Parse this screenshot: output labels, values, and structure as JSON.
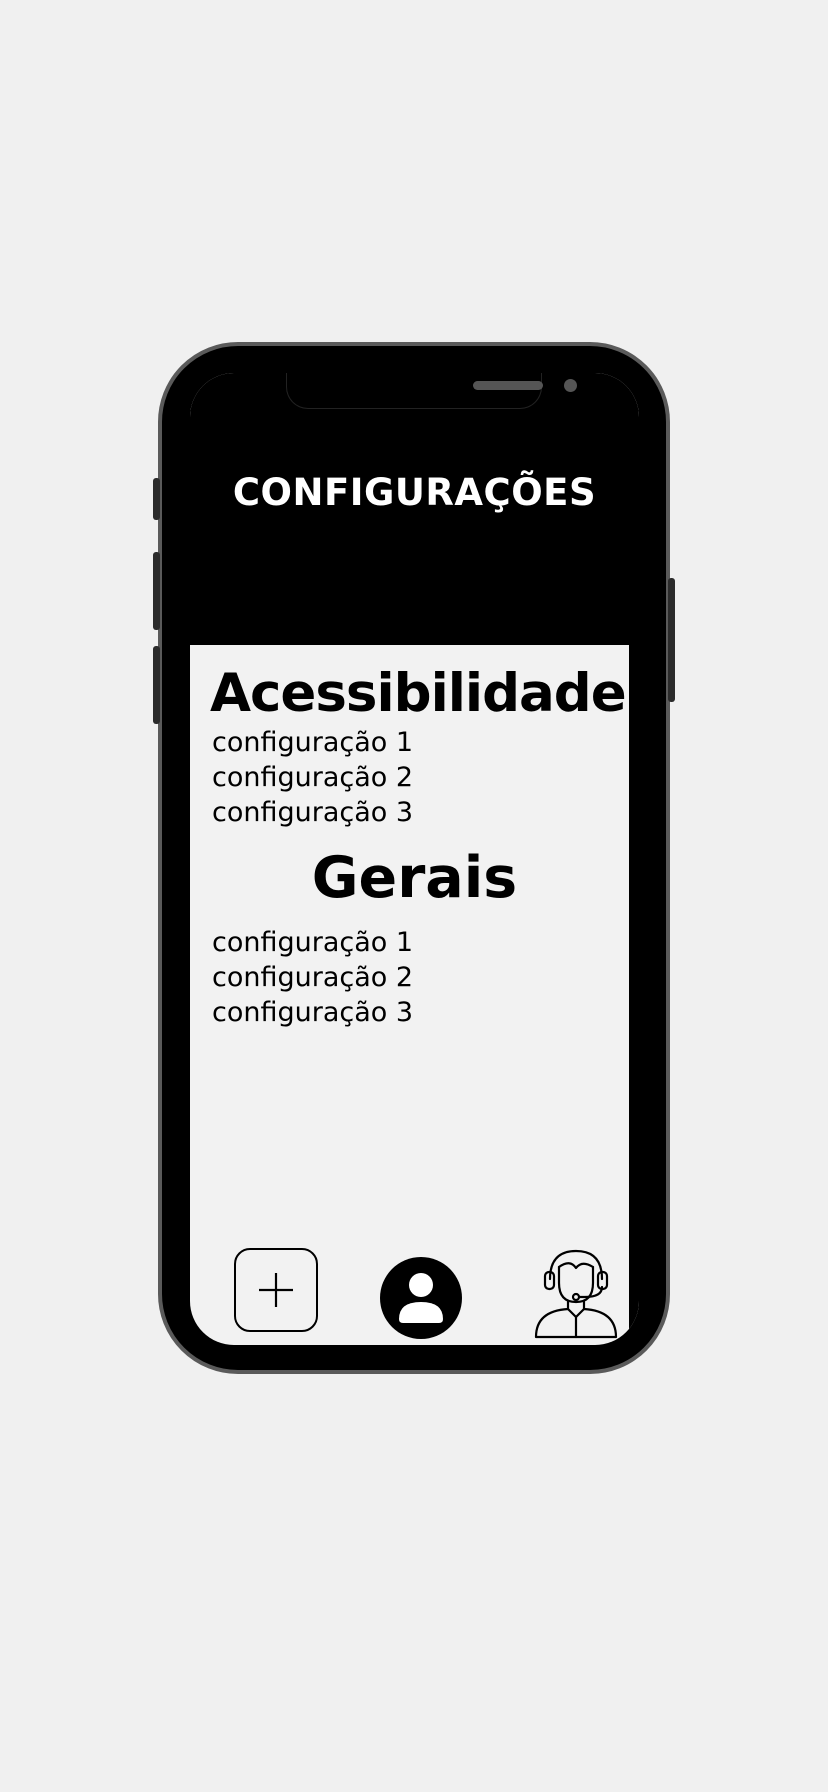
{
  "header": {
    "title": "CONFIGURAÇÕES"
  },
  "sections": [
    {
      "heading": "Acessibilidade",
      "items": [
        "configuração 1",
        "configuração 2",
        "configuração 3"
      ]
    },
    {
      "heading": "Gerais",
      "items": [
        "configuração 1",
        "configuração 2",
        "configuração 3"
      ]
    }
  ],
  "bottom_nav": {
    "items": [
      {
        "icon": "plus-icon"
      },
      {
        "icon": "user-profile-icon"
      },
      {
        "icon": "customer-support-headset-icon"
      }
    ]
  },
  "colors": {
    "background": "#f0f0f0",
    "phone_frame": "#000000",
    "phone_border": "#5a5a5a",
    "screen_background": "#f2f2f2",
    "header_background": "#000000",
    "header_text": "#ffffff",
    "text": "#000000"
  }
}
